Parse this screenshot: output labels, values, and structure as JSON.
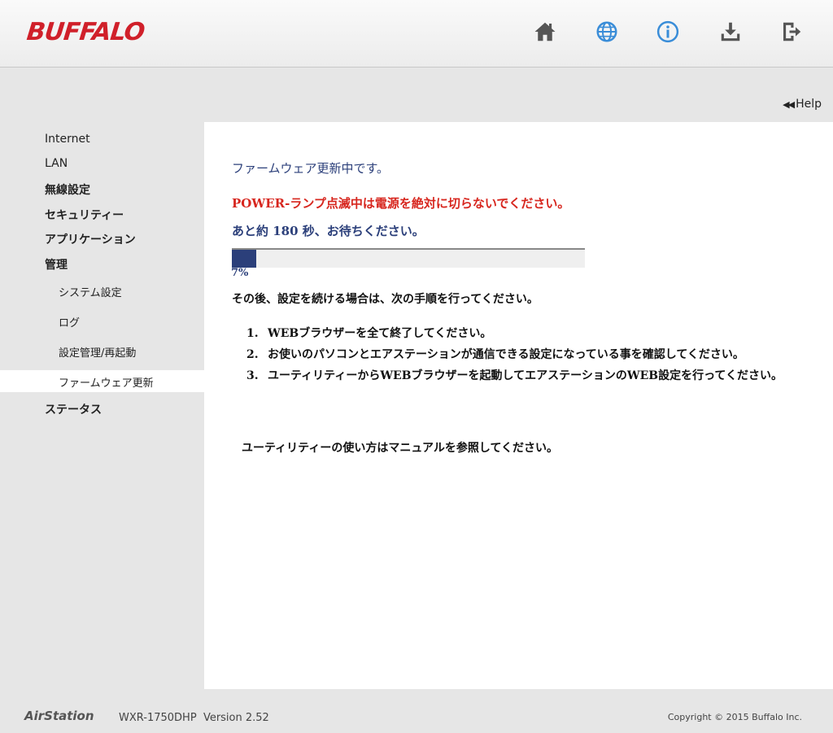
{
  "header": {
    "logo": "BUFFALO",
    "icons": [
      {
        "name": "home-icon",
        "color": "#555555"
      },
      {
        "name": "globe-icon",
        "color": "#3a8dd8"
      },
      {
        "name": "info-icon",
        "color": "#3a8dd8"
      },
      {
        "name": "download-icon",
        "color": "#555555"
      },
      {
        "name": "logout-icon",
        "color": "#555555"
      }
    ]
  },
  "help": {
    "label": "Help"
  },
  "sidebar": {
    "items": [
      {
        "label": "Internet"
      },
      {
        "label": "LAN"
      },
      {
        "label": "無線設定"
      },
      {
        "label": "セキュリティー"
      },
      {
        "label": "アプリケーション"
      },
      {
        "label": "管理"
      },
      {
        "label": "ステータス"
      }
    ],
    "sub_items": [
      {
        "label": "システム設定"
      },
      {
        "label": "ログ"
      },
      {
        "label": "設定管理/再起動"
      },
      {
        "label": "ファームウェア更新",
        "active": true
      }
    ]
  },
  "main": {
    "status_title": "ファームウェア更新中です。",
    "warning": "POWER-ランプ点滅中は電源を絶対に切らないでください。",
    "wait_text": "あと約 180 秒、お待ちください。",
    "progress_percent": 7,
    "progress_label": "7%",
    "after_text": "その後、設定を続ける場合は、次の手順を行ってください。",
    "steps": [
      {
        "num": "1.",
        "text": "WEBブラウザーを全て終了してください。"
      },
      {
        "num": "2.",
        "text": "お使いのパソコンとエアステーションが通信できる設定になっている事を確認してください。"
      },
      {
        "num": "3.",
        "text": "ユーティリティーからWEBブラウザーを起動してエアステーションのWEB設定を行ってください。"
      }
    ],
    "utility_text": "ユーティリティーの使い方はマニュアルを参照してください。"
  },
  "footer": {
    "brand": "AirStation",
    "model": "WXR-1750DHP",
    "version": "Version 2.52",
    "copyright": "Copyright © 2015 Buffalo Inc."
  },
  "colors": {
    "brand": "#d0202a",
    "accent": "#2b3f7a",
    "warning": "#d7261e"
  }
}
